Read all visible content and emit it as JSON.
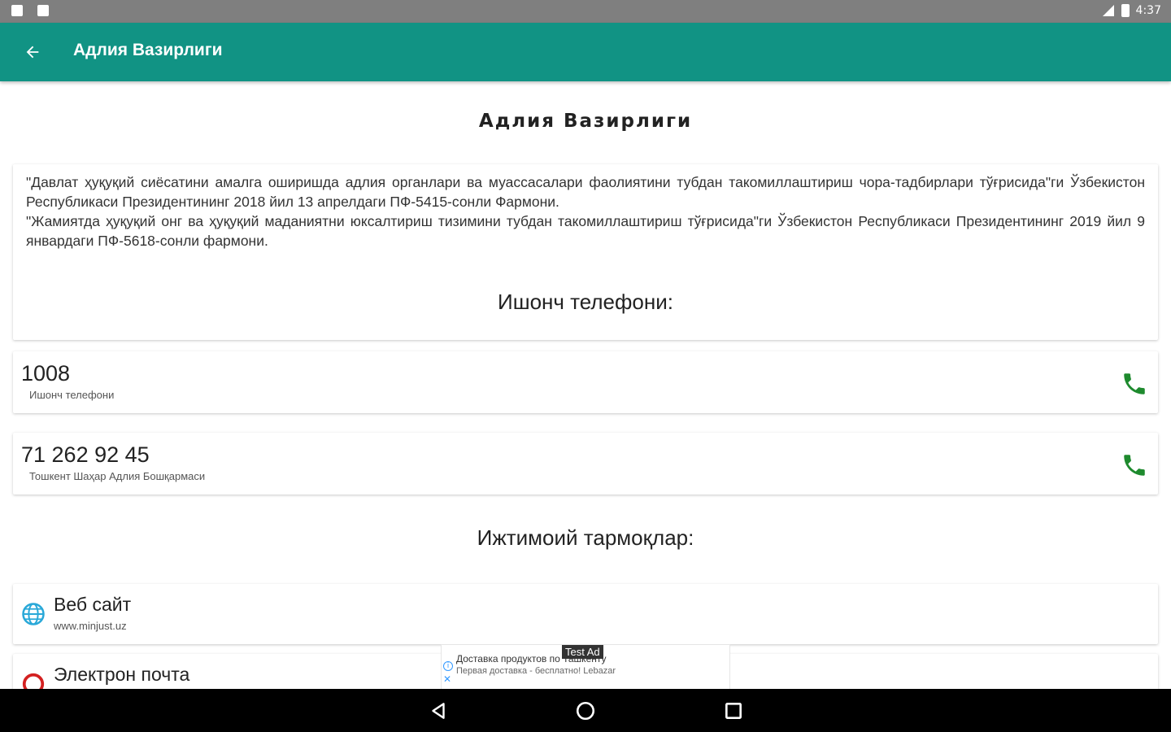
{
  "status_bar": {
    "time": "4:37"
  },
  "app_bar": {
    "title": "Адлия Вазирлиги",
    "back_icon": "arrow-left-icon"
  },
  "page": {
    "title": "Адлия Вазирлиги",
    "description": "\"Давлат ҳуқуқий сиёсатини амалга оширишда адлия органлари ва муассасалари фаолиятини тубдан такомиллаштириш чора-тадбирлари тўғрисида\"ги Ўзбекистон Республикаси Президентининг 2018 йил 13 апрелдаги ПФ-5415-сонли Фармони.\n\"Жамиятда ҳуқуқий онг ва ҳуқуқий маданиятни юксалтириш тизимини тубдан такомиллаштириш тўғрисида\"ги Ўзбекистон Республикаси Президентининг 2019 йил 9 январдаги ПФ-5618-сонли фармони."
  },
  "hotline": {
    "title": "Ишонч телефони:",
    "items": [
      {
        "number": "1008",
        "label": "Ишонч телефони"
      },
      {
        "number": "71 262 92 45",
        "label": "Тошкент Шаҳар Адлия Бошқармаси"
      }
    ]
  },
  "social": {
    "title": "Ижтимоий тармоқлар:",
    "items": [
      {
        "label": "Веб сайт",
        "sub": "www.minjust.uz",
        "icon": "globe-icon"
      },
      {
        "label": "Электрон почта",
        "sub": "",
        "icon": "email-icon"
      }
    ]
  },
  "ad": {
    "badge": "Test Ad",
    "line1": "Доставка продуктов по Ташкенту",
    "line2": "Первая доставка - бесплатно! Lebazar"
  },
  "colors": {
    "primary": "#119384",
    "call_icon": "#1e8a2e",
    "globe": "#29a8d8",
    "email": "#d32020"
  }
}
